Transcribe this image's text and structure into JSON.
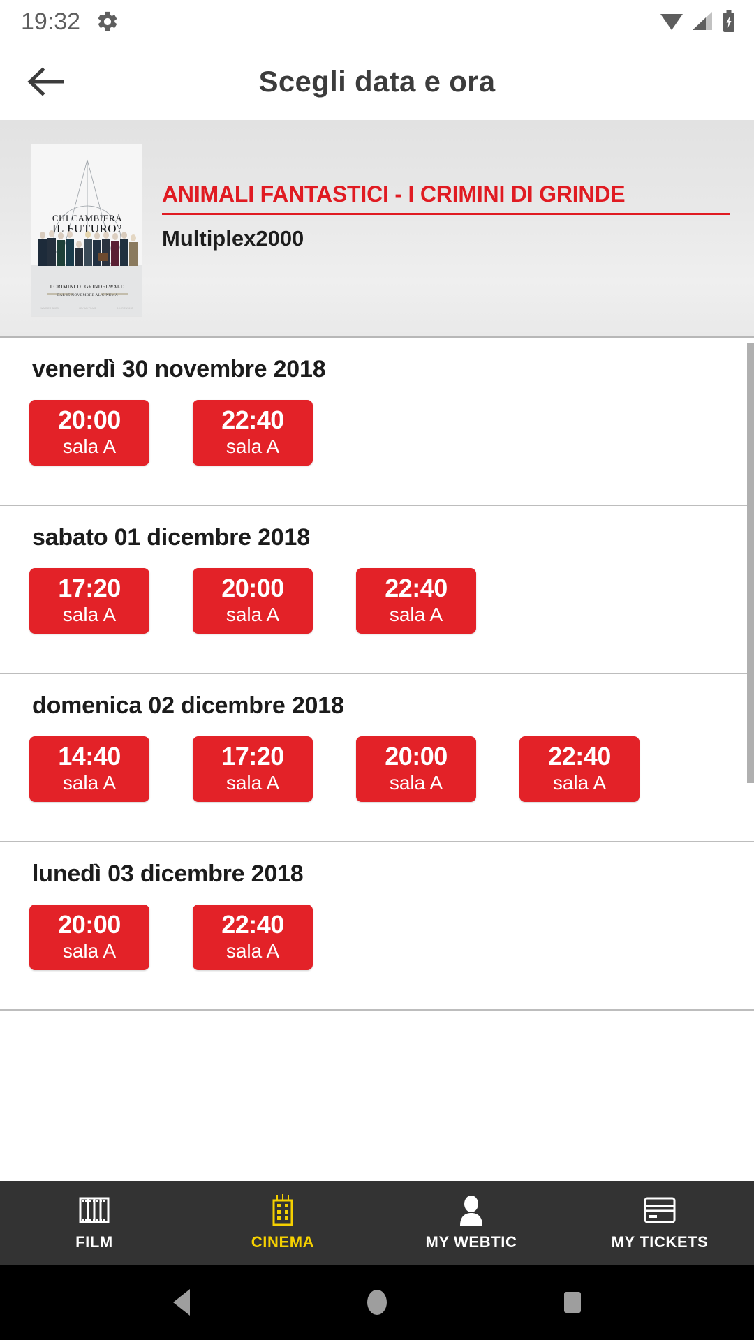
{
  "status_bar": {
    "clock": "19:32",
    "left_icons": [
      "gear-icon"
    ],
    "right_icons": [
      "wifi-icon",
      "signal-icon",
      "battery-charging-icon"
    ]
  },
  "app_bar": {
    "back_icon": "arrow-left-icon",
    "title": "Scegli data e ora"
  },
  "movie_header": {
    "poster": {
      "alt": "ANIMALI FANTASTICI - I CRIMINI DI GRINDELWALD poster",
      "tagline_line1": "CHI CAMBIERÀ",
      "tagline_line2": "IL FUTURO?",
      "bottom_title": "I CRIMINI DI GRINDELWALD",
      "bottom_subtitle": "DAL 15 NOVEMBRE AL CINEMA"
    },
    "title": "ANIMALI FANTASTICI - I CRIMINI DI GRINDE",
    "cinema": "Multiplex2000",
    "accent_color": "#e01b22"
  },
  "showtimes": {
    "hall_label": "sala A",
    "button_color": "#e32228",
    "groups": [
      {
        "date": "venerdì 30 novembre 2018",
        "times": [
          {
            "time": "20:00",
            "hall": "sala A"
          },
          {
            "time": "22:40",
            "hall": "sala A"
          }
        ]
      },
      {
        "date": "sabato 01 dicembre 2018",
        "times": [
          {
            "time": "17:20",
            "hall": "sala A"
          },
          {
            "time": "20:00",
            "hall": "sala A"
          },
          {
            "time": "22:40",
            "hall": "sala A"
          }
        ]
      },
      {
        "date": "domenica 02 dicembre 2018",
        "times": [
          {
            "time": "14:40",
            "hall": "sala A"
          },
          {
            "time": "17:20",
            "hall": "sala A"
          },
          {
            "time": "20:00",
            "hall": "sala A"
          },
          {
            "time": "22:40",
            "hall": "sala A"
          }
        ]
      },
      {
        "date": "lunedì 03 dicembre 2018",
        "times": [
          {
            "time": "20:00",
            "hall": "sala A"
          },
          {
            "time": "22:40",
            "hall": "sala A"
          }
        ]
      }
    ]
  },
  "bottom_nav": {
    "active_color": "#f5d000",
    "items": [
      {
        "label": "FILM",
        "icon": "film-strip-icon",
        "active": false
      },
      {
        "label": "CINEMA",
        "icon": "building-icon",
        "active": true
      },
      {
        "label": "MY WEBTIC",
        "icon": "person-icon",
        "active": false
      },
      {
        "label": "MY TICKETS",
        "icon": "credit-card-icon",
        "active": false
      }
    ]
  },
  "android_nav": {
    "keys": [
      "back-triangle-icon",
      "home-circle-icon",
      "recents-square-icon"
    ]
  }
}
